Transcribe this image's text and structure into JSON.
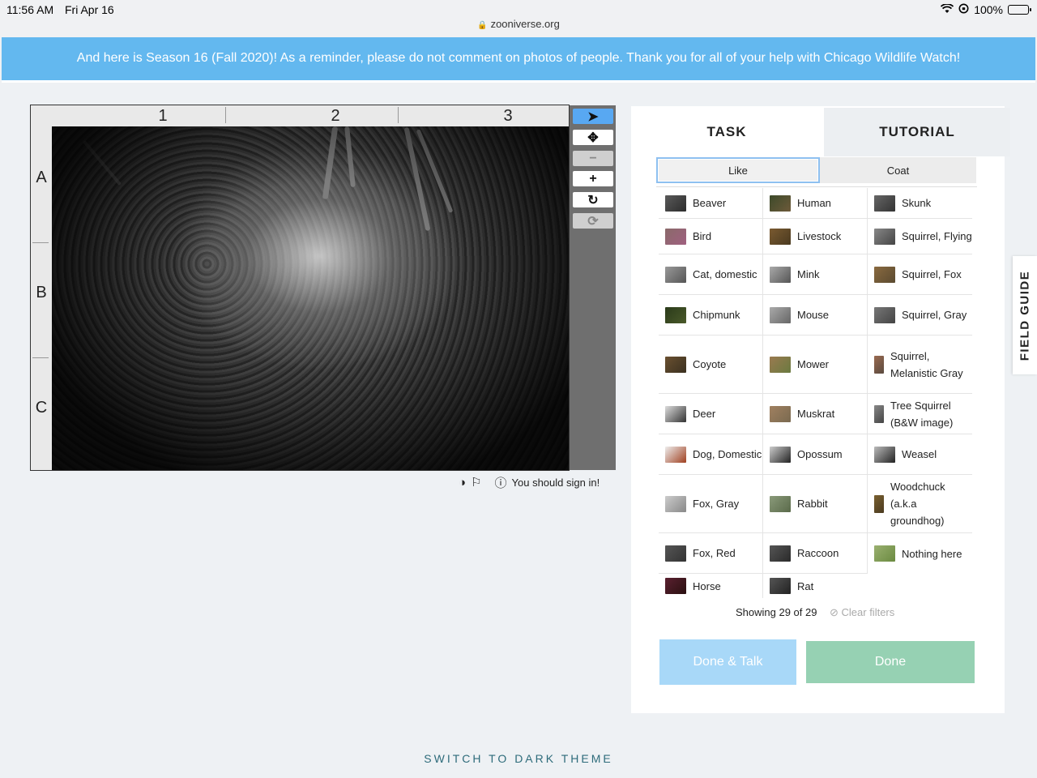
{
  "status_bar": {
    "time": "11:56 AM",
    "date": "Fri Apr 16",
    "battery": "100%",
    "url": "zooniverse.org"
  },
  "banner": {
    "text": "And here is Season 16 (Fall 2020)! As a reminder, please do not comment on photos of people. Thank you for all of your help with Chicago Wildlife Watch!"
  },
  "viewer": {
    "columns": [
      "1",
      "2",
      "3"
    ],
    "rows": [
      "A",
      "B",
      "C"
    ],
    "tools": {
      "pointer": "➤",
      "move": "✥",
      "zoom_out": "−",
      "zoom_in": "+",
      "rotate": "↻",
      "reset": "⟳"
    }
  },
  "meta": {
    "sign_in_text": "You should sign in!"
  },
  "panel": {
    "tabs": {
      "task": "TASK",
      "tutorial": "TUTORIAL"
    },
    "subtabs": {
      "like": "Like",
      "coat": "Coat"
    },
    "species": [
      [
        "Beaver",
        "Human",
        "Skunk"
      ],
      [
        "Bird",
        "Livestock",
        "Squirrel, Flying"
      ],
      [
        "Cat, domestic",
        "Mink",
        "Squirrel, Fox"
      ],
      [
        "Chipmunk",
        "Mouse",
        "Squirrel, Gray"
      ],
      [
        "Coyote",
        "Mower",
        "Squirrel, Melanistic Gray"
      ],
      [
        "Deer",
        "Muskrat",
        "Tree Squirrel (B&W image)"
      ],
      [
        "Dog, Domestic",
        "Opossum",
        "Weasel"
      ],
      [
        "Fox, Gray",
        "Rabbit",
        "Woodchuck (a.k.a groundhog)"
      ],
      [
        "Fox, Red",
        "Raccoon",
        "Nothing here"
      ],
      [
        "Horse",
        "Rat",
        ""
      ]
    ],
    "showing": "Showing 29 of 29",
    "clear_filters": "Clear filters",
    "done_talk": "Done & Talk",
    "done": "Done"
  },
  "field_guide": "FIELD GUIDE",
  "footer": {
    "dark_theme": "SWITCH TO DARK THEME"
  },
  "colors": {
    "banner": "#63b8ef",
    "done": "#96d1b3",
    "done_talk": "#a8d8f8",
    "active_tool": "#58a8f2"
  }
}
